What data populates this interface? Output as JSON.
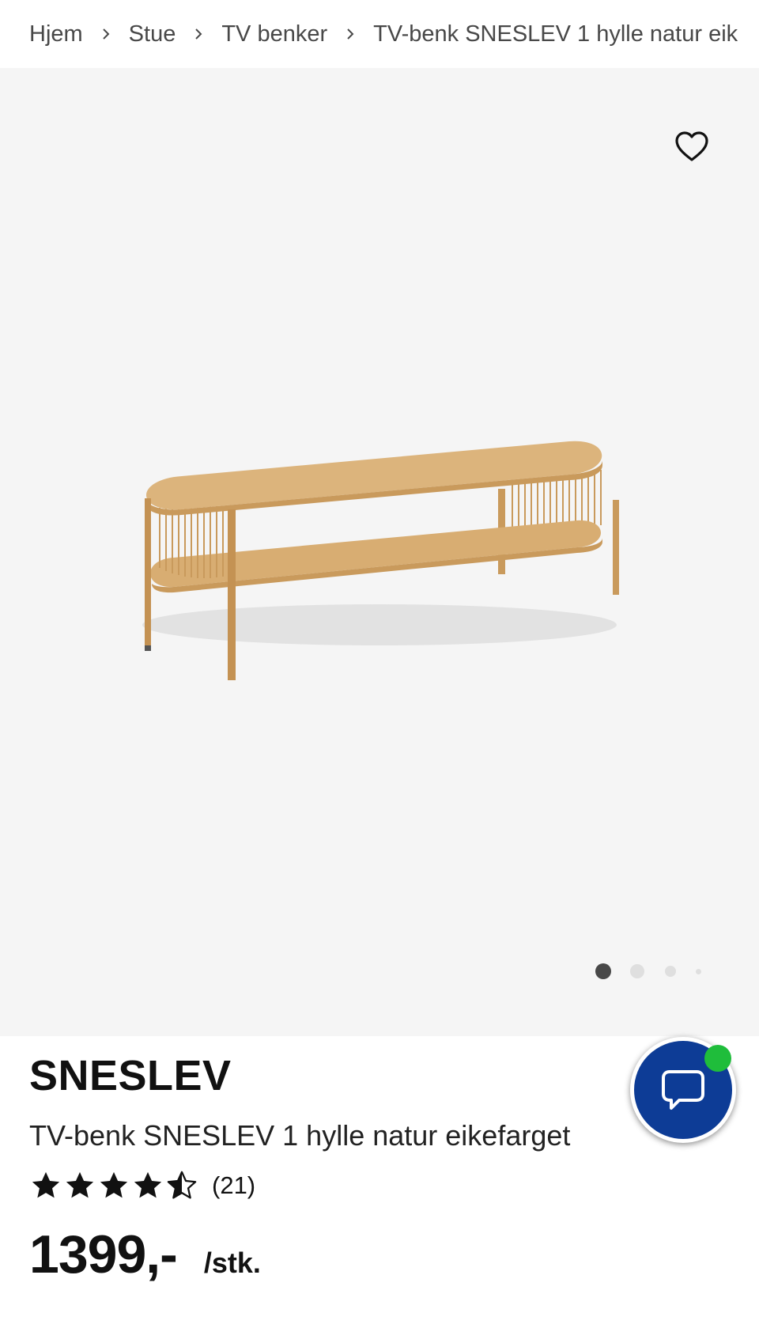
{
  "breadcrumb": {
    "items": [
      "Hjem",
      "Stue",
      "TV benker",
      "TV-benk SNESLEV 1 hylle natur eik"
    ]
  },
  "gallery": {
    "background": "#f5f5f5",
    "favorite_icon": "heart-outline-icon",
    "image_count": 4,
    "active_image": 1
  },
  "product": {
    "brand": "SNESLEV",
    "title": "TV-benk SNESLEV 1 hylle natur eikefarget",
    "rating": 4.5,
    "rating_max": 5,
    "review_count": "(21)",
    "price": "1399,-",
    "unit": "/stk."
  },
  "chat": {
    "icon": "chat-bubble-icon",
    "color": "#0d3c96",
    "status_color": "#1fbd3b"
  }
}
